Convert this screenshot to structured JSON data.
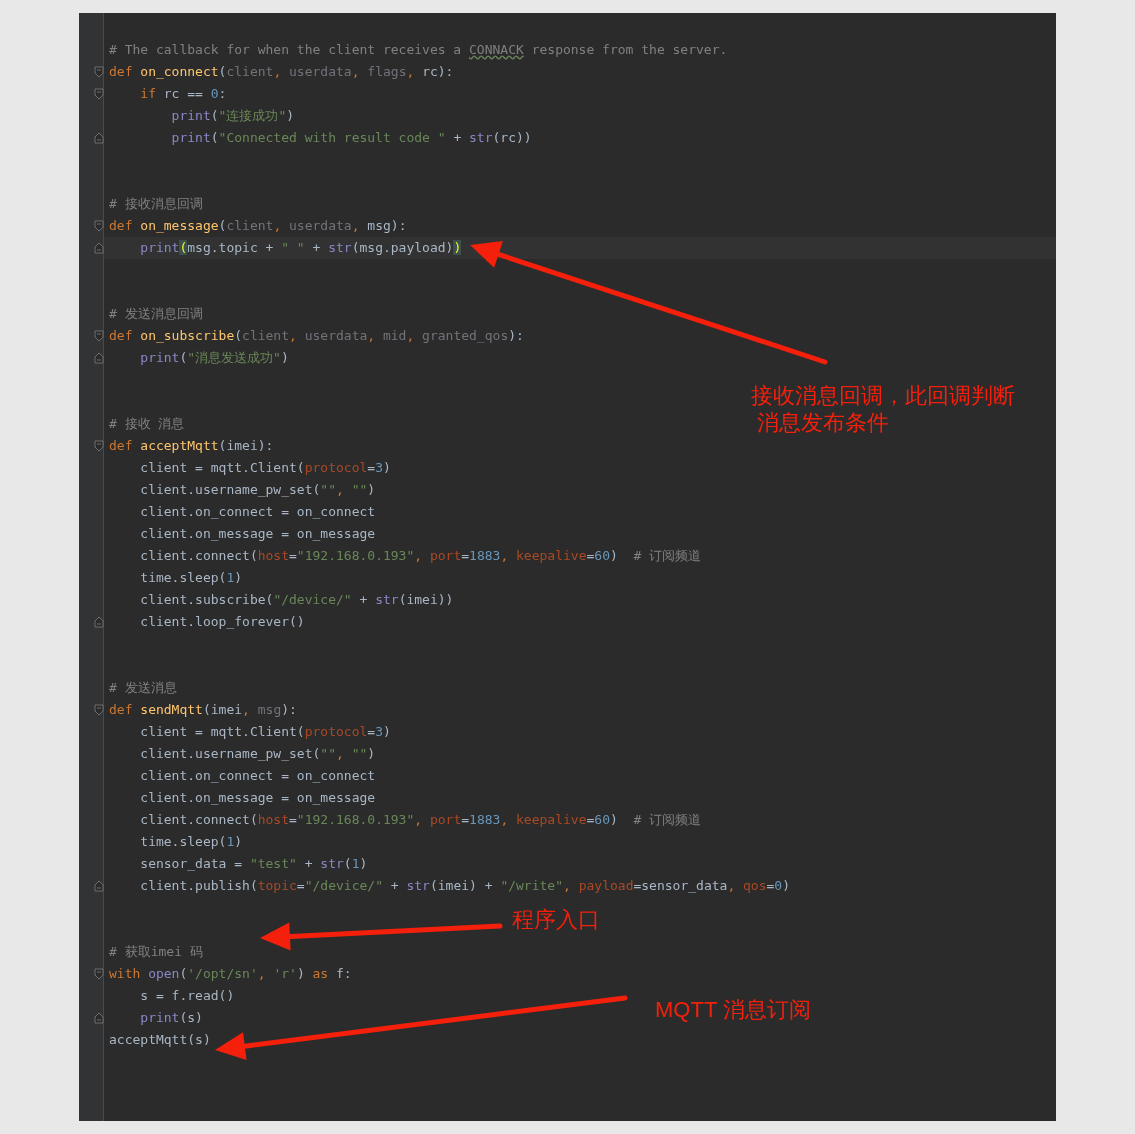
{
  "editor": {
    "blocks": [
      {
        "lines": [
          {
            "kind": "code",
            "tokens": [
              {
                "kind": "comment",
                "text": "# The callback for when the client receives a "
              },
              {
                "kind": "typo",
                "text": "CONNACK"
              },
              {
                "kind": "comment",
                "text": " response from the server."
              }
            ]
          },
          {
            "kind": "fold_start",
            "tokens": [
              {
                "kind": "kw",
                "text": "def "
              },
              {
                "kind": "fn",
                "text": "on_connect"
              },
              {
                "kind": "plain",
                "text": "("
              },
              {
                "kind": "param",
                "text": "client"
              },
              {
                "kind": "kw",
                "text": ", "
              },
              {
                "kind": "param",
                "text": "userdata"
              },
              {
                "kind": "kw",
                "text": ", "
              },
              {
                "kind": "param",
                "text": "flags"
              },
              {
                "kind": "kw",
                "text": ", "
              },
              {
                "kind": "plain",
                "text": "rc):"
              }
            ]
          },
          {
            "kind": "fold_start",
            "tokens": [
              {
                "kind": "kw",
                "text": "    if"
              },
              {
                "kind": "plain",
                "text": " rc == "
              },
              {
                "kind": "num",
                "text": "0"
              },
              {
                "kind": "plain",
                "text": ":"
              }
            ]
          },
          {
            "kind": "code",
            "tokens": [
              {
                "kind": "builtin",
                "text": "        print"
              },
              {
                "kind": "plain",
                "text": "("
              },
              {
                "kind": "str",
                "text": "\"连接成功\""
              },
              {
                "kind": "plain",
                "text": ")"
              }
            ]
          },
          {
            "kind": "fold_end",
            "tokens": [
              {
                "kind": "builtin",
                "text": "        print"
              },
              {
                "kind": "plain",
                "text": "("
              },
              {
                "kind": "str",
                "text": "\"Connected with result code \""
              },
              {
                "kind": "plain",
                "text": " + "
              },
              {
                "kind": "builtin",
                "text": "str"
              },
              {
                "kind": "plain",
                "text": "(rc))"
              }
            ]
          }
        ]
      },
      {
        "lines": [
          {
            "kind": "code",
            "tokens": [
              {
                "kind": "comment",
                "text": "# 接收消息回调"
              }
            ]
          },
          {
            "kind": "fold_start",
            "tokens": [
              {
                "kind": "kw",
                "text": "def "
              },
              {
                "kind": "fn",
                "text": "on_message"
              },
              {
                "kind": "plain",
                "text": "("
              },
              {
                "kind": "param",
                "text": "client"
              },
              {
                "kind": "kw",
                "text": ", "
              },
              {
                "kind": "param",
                "text": "userdata"
              },
              {
                "kind": "kw",
                "text": ", "
              },
              {
                "kind": "plain",
                "text": "msg):"
              }
            ]
          },
          {
            "kind": "fold_end",
            "current": true,
            "tokens": [
              {
                "kind": "builtin",
                "text": "    print"
              },
              {
                "kind": "match",
                "text": "("
              },
              {
                "kind": "plain",
                "text": "msg.topic + "
              },
              {
                "kind": "str",
                "text": "\" \""
              },
              {
                "kind": "plain",
                "text": " + "
              },
              {
                "kind": "builtin",
                "text": "str"
              },
              {
                "kind": "plain",
                "text": "(msg.payload)"
              },
              {
                "kind": "match",
                "text": ")"
              }
            ]
          }
        ]
      },
      {
        "lines": [
          {
            "kind": "code",
            "tokens": [
              {
                "kind": "comment",
                "text": "# 发送消息回调"
              }
            ]
          },
          {
            "kind": "fold_start",
            "tokens": [
              {
                "kind": "kw",
                "text": "def "
              },
              {
                "kind": "fn",
                "text": "on_subscribe"
              },
              {
                "kind": "plain",
                "text": "("
              },
              {
                "kind": "param",
                "text": "client"
              },
              {
                "kind": "kw",
                "text": ", "
              },
              {
                "kind": "param",
                "text": "userdata"
              },
              {
                "kind": "kw",
                "text": ", "
              },
              {
                "kind": "param",
                "text": "mid"
              },
              {
                "kind": "kw",
                "text": ", "
              },
              {
                "kind": "param",
                "text": "granted_qos"
              },
              {
                "kind": "plain",
                "text": "):"
              }
            ]
          },
          {
            "kind": "fold_end",
            "tokens": [
              {
                "kind": "builtin",
                "text": "    print"
              },
              {
                "kind": "plain",
                "text": "("
              },
              {
                "kind": "str",
                "text": "\"消息发送成功\""
              },
              {
                "kind": "plain",
                "text": ")"
              }
            ]
          }
        ]
      },
      {
        "lines": [
          {
            "kind": "code",
            "tokens": [
              {
                "kind": "comment",
                "text": "# 接收 消息"
              }
            ]
          },
          {
            "kind": "fold_start",
            "tokens": [
              {
                "kind": "kw",
                "text": "def "
              },
              {
                "kind": "fn",
                "text": "acceptMqtt"
              },
              {
                "kind": "plain",
                "text": "(imei):"
              }
            ]
          },
          {
            "kind": "code",
            "tokens": [
              {
                "kind": "plain",
                "text": "    client = mqtt.Client("
              },
              {
                "kind": "kwarg",
                "text": "protocol"
              },
              {
                "kind": "plain",
                "text": "="
              },
              {
                "kind": "num",
                "text": "3"
              },
              {
                "kind": "plain",
                "text": ")"
              }
            ]
          },
          {
            "kind": "code",
            "tokens": [
              {
                "kind": "plain",
                "text": "    client.username_pw_set("
              },
              {
                "kind": "str",
                "text": "\"\""
              },
              {
                "kind": "kw",
                "text": ", "
              },
              {
                "kind": "str",
                "text": "\"\""
              },
              {
                "kind": "plain",
                "text": ")"
              }
            ]
          },
          {
            "kind": "code",
            "tokens": [
              {
                "kind": "plain",
                "text": "    client.on_connect = on_connect"
              }
            ]
          },
          {
            "kind": "code",
            "tokens": [
              {
                "kind": "plain",
                "text": "    client.on_message = on_message"
              }
            ]
          },
          {
            "kind": "code",
            "tokens": [
              {
                "kind": "plain",
                "text": "    client.connect("
              },
              {
                "kind": "kwarg",
                "text": "host"
              },
              {
                "kind": "plain",
                "text": "="
              },
              {
                "kind": "str",
                "text": "\"192.168.0.193\""
              },
              {
                "kind": "kw",
                "text": ", "
              },
              {
                "kind": "kwarg",
                "text": "port"
              },
              {
                "kind": "plain",
                "text": "="
              },
              {
                "kind": "num",
                "text": "1883"
              },
              {
                "kind": "kw",
                "text": ", "
              },
              {
                "kind": "kwarg",
                "text": "keepalive"
              },
              {
                "kind": "plain",
                "text": "="
              },
              {
                "kind": "num",
                "text": "60"
              },
              {
                "kind": "plain",
                "text": ")"
              },
              {
                "kind": "comment",
                "text": "  # 订阅频道"
              }
            ]
          },
          {
            "kind": "code",
            "tokens": [
              {
                "kind": "plain",
                "text": "    time.sleep("
              },
              {
                "kind": "num",
                "text": "1"
              },
              {
                "kind": "plain",
                "text": ")"
              }
            ]
          },
          {
            "kind": "code",
            "tokens": [
              {
                "kind": "plain",
                "text": "    client.subscribe("
              },
              {
                "kind": "str",
                "text": "\"/device/\""
              },
              {
                "kind": "plain",
                "text": " + "
              },
              {
                "kind": "builtin",
                "text": "str"
              },
              {
                "kind": "plain",
                "text": "(imei))"
              }
            ]
          },
          {
            "kind": "fold_end",
            "tokens": [
              {
                "kind": "plain",
                "text": "    client.loop_forever()"
              }
            ]
          }
        ]
      },
      {
        "lines": [
          {
            "kind": "code",
            "tokens": [
              {
                "kind": "comment",
                "text": "# 发送消息"
              }
            ]
          },
          {
            "kind": "fold_start",
            "tokens": [
              {
                "kind": "kw",
                "text": "def "
              },
              {
                "kind": "fn",
                "text": "sendMqtt"
              },
              {
                "kind": "plain",
                "text": "(imei"
              },
              {
                "kind": "kw",
                "text": ", "
              },
              {
                "kind": "param",
                "text": "msg"
              },
              {
                "kind": "plain",
                "text": "):"
              }
            ]
          },
          {
            "kind": "code",
            "tokens": [
              {
                "kind": "plain",
                "text": "    client = mqtt.Client("
              },
              {
                "kind": "kwarg",
                "text": "protocol"
              },
              {
                "kind": "plain",
                "text": "="
              },
              {
                "kind": "num",
                "text": "3"
              },
              {
                "kind": "plain",
                "text": ")"
              }
            ]
          },
          {
            "kind": "code",
            "tokens": [
              {
                "kind": "plain",
                "text": "    client.username_pw_set("
              },
              {
                "kind": "str",
                "text": "\"\""
              },
              {
                "kind": "kw",
                "text": ", "
              },
              {
                "kind": "str",
                "text": "\"\""
              },
              {
                "kind": "plain",
                "text": ")"
              }
            ]
          },
          {
            "kind": "code",
            "tokens": [
              {
                "kind": "plain",
                "text": "    client.on_connect = on_connect"
              }
            ]
          },
          {
            "kind": "code",
            "tokens": [
              {
                "kind": "plain",
                "text": "    client.on_message = on_message"
              }
            ]
          },
          {
            "kind": "code",
            "tokens": [
              {
                "kind": "plain",
                "text": "    client.connect("
              },
              {
                "kind": "kwarg",
                "text": "host"
              },
              {
                "kind": "plain",
                "text": "="
              },
              {
                "kind": "str",
                "text": "\"192.168.0.193\""
              },
              {
                "kind": "kw",
                "text": ", "
              },
              {
                "kind": "kwarg",
                "text": "port"
              },
              {
                "kind": "plain",
                "text": "="
              },
              {
                "kind": "num",
                "text": "1883"
              },
              {
                "kind": "kw",
                "text": ", "
              },
              {
                "kind": "kwarg",
                "text": "keepalive"
              },
              {
                "kind": "plain",
                "text": "="
              },
              {
                "kind": "num",
                "text": "60"
              },
              {
                "kind": "plain",
                "text": ")"
              },
              {
                "kind": "comment",
                "text": "  # 订阅频道"
              }
            ]
          },
          {
            "kind": "code",
            "tokens": [
              {
                "kind": "plain",
                "text": "    time.sleep("
              },
              {
                "kind": "num",
                "text": "1"
              },
              {
                "kind": "plain",
                "text": ")"
              }
            ]
          },
          {
            "kind": "code",
            "tokens": [
              {
                "kind": "plain",
                "text": "    sensor_data = "
              },
              {
                "kind": "str",
                "text": "\"test\""
              },
              {
                "kind": "plain",
                "text": " + "
              },
              {
                "kind": "builtin",
                "text": "str"
              },
              {
                "kind": "plain",
                "text": "("
              },
              {
                "kind": "num",
                "text": "1"
              },
              {
                "kind": "plain",
                "text": ")"
              }
            ]
          },
          {
            "kind": "fold_end",
            "tokens": [
              {
                "kind": "plain",
                "text": "    client.publish("
              },
              {
                "kind": "kwarg",
                "text": "topic"
              },
              {
                "kind": "plain",
                "text": "="
              },
              {
                "kind": "str",
                "text": "\"/device/\""
              },
              {
                "kind": "plain",
                "text": " + "
              },
              {
                "kind": "builtin",
                "text": "str"
              },
              {
                "kind": "plain",
                "text": "(imei) + "
              },
              {
                "kind": "str",
                "text": "\"/write\""
              },
              {
                "kind": "kw",
                "text": ", "
              },
              {
                "kind": "kwarg",
                "text": "payload"
              },
              {
                "kind": "plain",
                "text": "=sensor_data"
              },
              {
                "kind": "kw",
                "text": ", "
              },
              {
                "kind": "kwarg",
                "text": "qos"
              },
              {
                "kind": "plain",
                "text": "="
              },
              {
                "kind": "num",
                "text": "0"
              },
              {
                "kind": "plain",
                "text": ")"
              }
            ]
          }
        ]
      },
      {
        "lines": [
          {
            "kind": "code",
            "tokens": [
              {
                "kind": "comment",
                "text": "# 获取imei 码"
              }
            ]
          },
          {
            "kind": "fold_start",
            "tokens": [
              {
                "kind": "kw",
                "text": "with "
              },
              {
                "kind": "builtin",
                "text": "open"
              },
              {
                "kind": "plain",
                "text": "("
              },
              {
                "kind": "str",
                "text": "'/opt/sn'"
              },
              {
                "kind": "kw",
                "text": ", "
              },
              {
                "kind": "str",
                "text": "'r'"
              },
              {
                "kind": "plain",
                "text": ") "
              },
              {
                "kind": "kw",
                "text": "as"
              },
              {
                "kind": "plain",
                "text": " f:"
              }
            ]
          },
          {
            "kind": "code",
            "tokens": [
              {
                "kind": "plain",
                "text": "    s = f.read()"
              }
            ]
          },
          {
            "kind": "fold_end",
            "tokens": [
              {
                "kind": "builtin",
                "text": "    print"
              },
              {
                "kind": "plain",
                "text": "(s)"
              }
            ]
          },
          {
            "kind": "code",
            "tokens": [
              {
                "kind": "plain",
                "text": "acceptMqtt(s)"
              }
            ]
          }
        ]
      }
    ]
  },
  "annotations": [
    {
      "lines": [
        "接收消息回调，此回调判断",
        " 消息发布条件"
      ]
    },
    {
      "lines": [
        "程序入口"
      ]
    },
    {
      "lines": [
        "MQTT 消息订阅"
      ]
    }
  ]
}
